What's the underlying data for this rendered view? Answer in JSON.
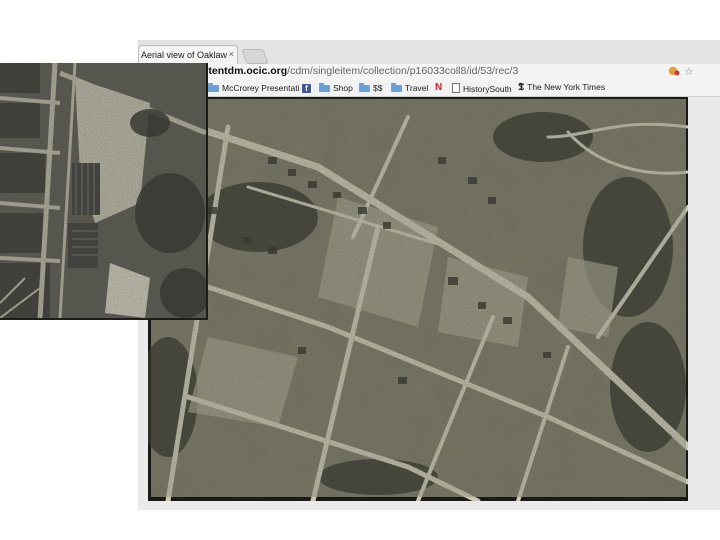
{
  "browser": {
    "tab": {
      "title": "Aerial view of Oaklawn Ave",
      "close_symbol": "×"
    },
    "address": {
      "host": "ntentdm.ocic.org",
      "path": "/cdm/singleitem/collection/p16033coll8/id/53/rec/3"
    },
    "bookmarks": [
      {
        "label": "McCrorey Presentati",
        "icon": "folder-icon"
      },
      {
        "label": "Shop",
        "icon": "facebook-icon+folder-icon"
      },
      {
        "label": "$$",
        "icon": "folder-icon"
      },
      {
        "label": "Travel",
        "icon": "folder-icon"
      },
      {
        "label": "HistorySouth",
        "icon": "netflix-icon+document-icon"
      },
      {
        "label": "The New York Times",
        "icon": "nyt-icon"
      }
    ]
  },
  "colors": {
    "photo_dark": "#1a1a16",
    "photo_mid": "#7a7866",
    "road": "#c9c6b2",
    "folder": "#6e9fd2",
    "facebook": "#3b5998",
    "netflix": "#d81f26"
  }
}
